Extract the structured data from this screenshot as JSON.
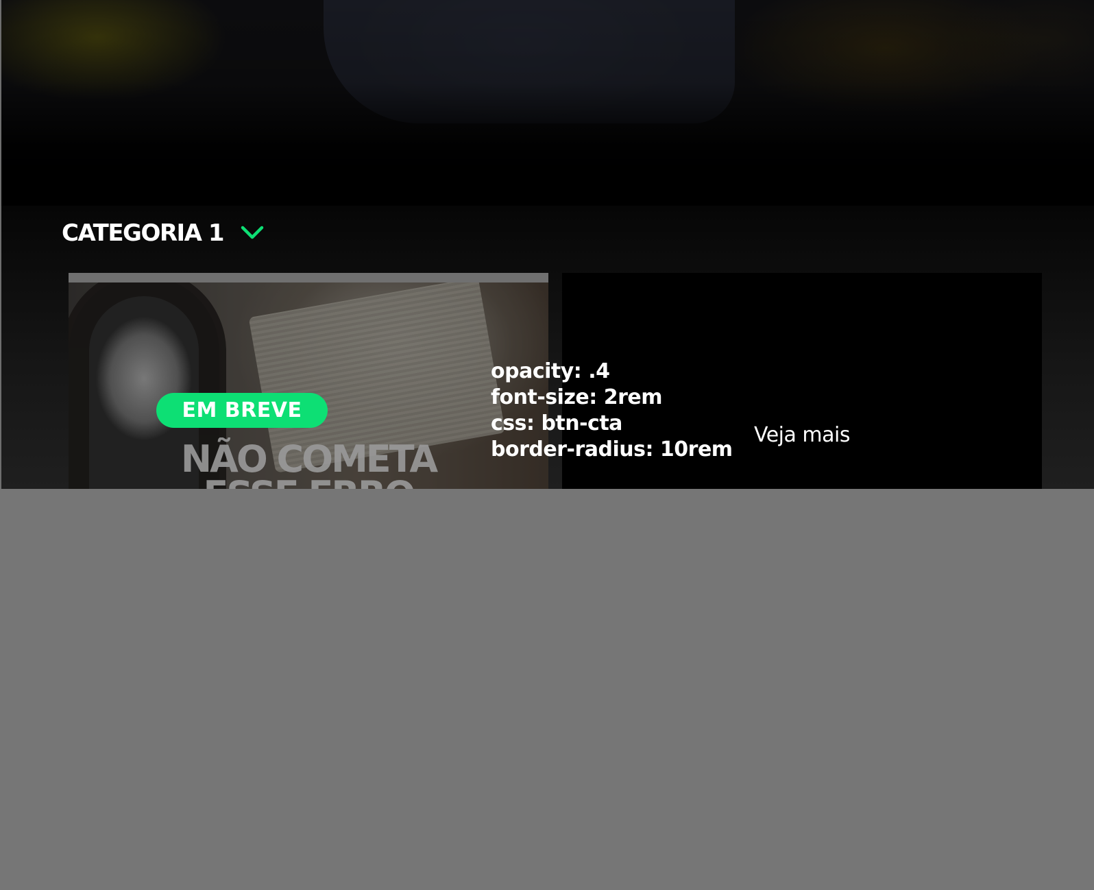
{
  "category": {
    "title": "CATEGORIA 1",
    "toggle_icon": "chevron-down-icon",
    "accent_color": "#0ddf74"
  },
  "cards": [
    {
      "headline_lines": [
        "NÃO COMETA",
        "ESSE ERRO"
      ],
      "cta_label": "EM BREVE",
      "cta_color": "#0ddf74"
    },
    {
      "link_label": "Veja mais"
    }
  ],
  "annotation_notes": [
    "opacity: .4",
    "font-size: 2rem",
    "css: btn-cta",
    "border-radius: 10rem"
  ],
  "colors": {
    "background_lower": "#767676",
    "card_dark": "#000000",
    "text": "#ffffff"
  }
}
